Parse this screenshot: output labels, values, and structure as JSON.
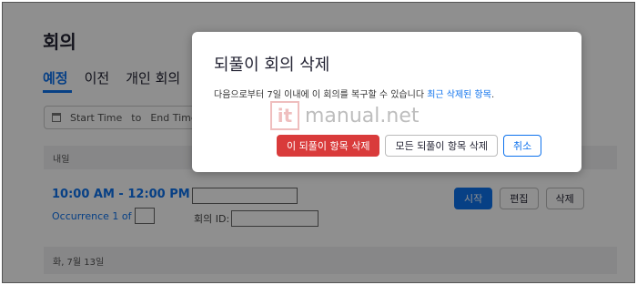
{
  "page": {
    "title": "회의",
    "tabs": [
      "예정",
      "이전",
      "개인 회의"
    ],
    "date_filter": {
      "start": "Start Time",
      "to": "to",
      "end": "End Time"
    },
    "section_header": "내일",
    "meeting": {
      "time": "10:00 AM - 12:00 PM",
      "occurrence": "Occurrence 1 of",
      "id_label": "회의 ID:",
      "buttons": {
        "start": "시작",
        "edit": "편집",
        "delete": "삭제"
      }
    },
    "next_section": "화, 7월 13일"
  },
  "modal": {
    "title": "되풀이 회의 삭제",
    "message_prefix": "다음으로부터 7일 이내에 이 회의를 복구할 수 있습니다",
    "message_link": "최근 삭제된 항목",
    "message_suffix": ".",
    "buttons": {
      "delete_this": "이 되풀이 항목 삭제",
      "delete_all": "모든 되풀이 항목 삭제",
      "cancel": "취소"
    }
  },
  "watermark": {
    "icon_text": "it",
    "text": "manual.net"
  },
  "colors": {
    "accent": "#0e72ed",
    "danger": "#d93b3b"
  }
}
